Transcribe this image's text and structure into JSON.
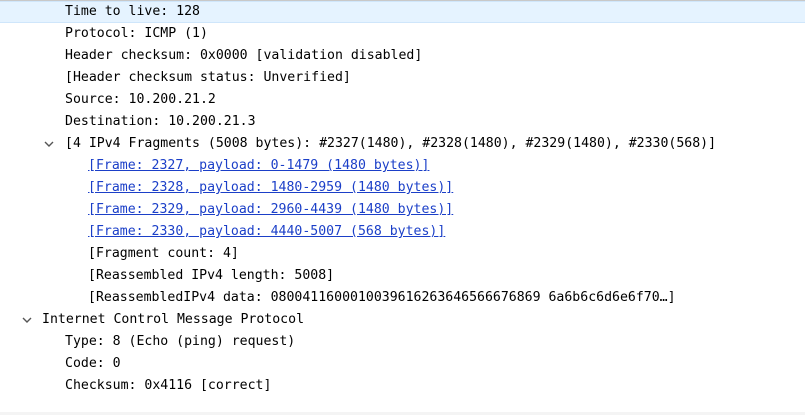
{
  "tree": {
    "rows": [
      {
        "text": "Time to live: 128",
        "indent": 1,
        "selected": true
      },
      {
        "text": "Protocol: ICMP (1)",
        "indent": 1
      },
      {
        "text": "Header checksum: 0x0000 [validation disabled]",
        "indent": 1
      },
      {
        "text": "[Header checksum status: Unverified]",
        "indent": 1
      },
      {
        "text": "Source: 10.200.21.2",
        "indent": 1
      },
      {
        "text": "Destination: 10.200.21.3",
        "indent": 1
      },
      {
        "text": "[4 IPv4 Fragments (5008 bytes): #2327(1480), #2328(1480), #2329(1480), #2330(568)]",
        "indent": 1,
        "expander": "chevron-down-icon"
      },
      {
        "text": "[Frame: 2327, payload: 0-1479 (1480 bytes)]",
        "indent": 2,
        "link": true
      },
      {
        "text": "[Frame: 2328, payload: 1480-2959 (1480 bytes)]",
        "indent": 2,
        "link": true
      },
      {
        "text": "[Frame: 2329, payload: 2960-4439 (1480 bytes)]",
        "indent": 2,
        "link": true
      },
      {
        "text": "[Frame: 2330, payload: 4440-5007 (568 bytes)]",
        "indent": 2,
        "link": true
      },
      {
        "text": "[Fragment count: 4]",
        "indent": 2
      },
      {
        "text": "[Reassembled IPv4 length: 5008]",
        "indent": 2
      },
      {
        "text": "[Reassembled IPv4 data: 080041160001003961626364656667686 96a6b6c6d6e6f70…]",
        "indent": 2
      },
      {
        "text": "Internet Control Message Protocol",
        "indent": 0,
        "expander": "chevron-down-icon"
      },
      {
        "text": "Type: 8 (Echo (ping) request)",
        "indent": 1
      },
      {
        "text": "Code: 0",
        "indent": 1
      },
      {
        "text": "Checksum: 0x4116 [correct]",
        "indent": 1
      }
    ]
  },
  "colors": {
    "selection_bg": "#e5f3ff",
    "link": "#1b3fc8",
    "text": "#000000"
  }
}
